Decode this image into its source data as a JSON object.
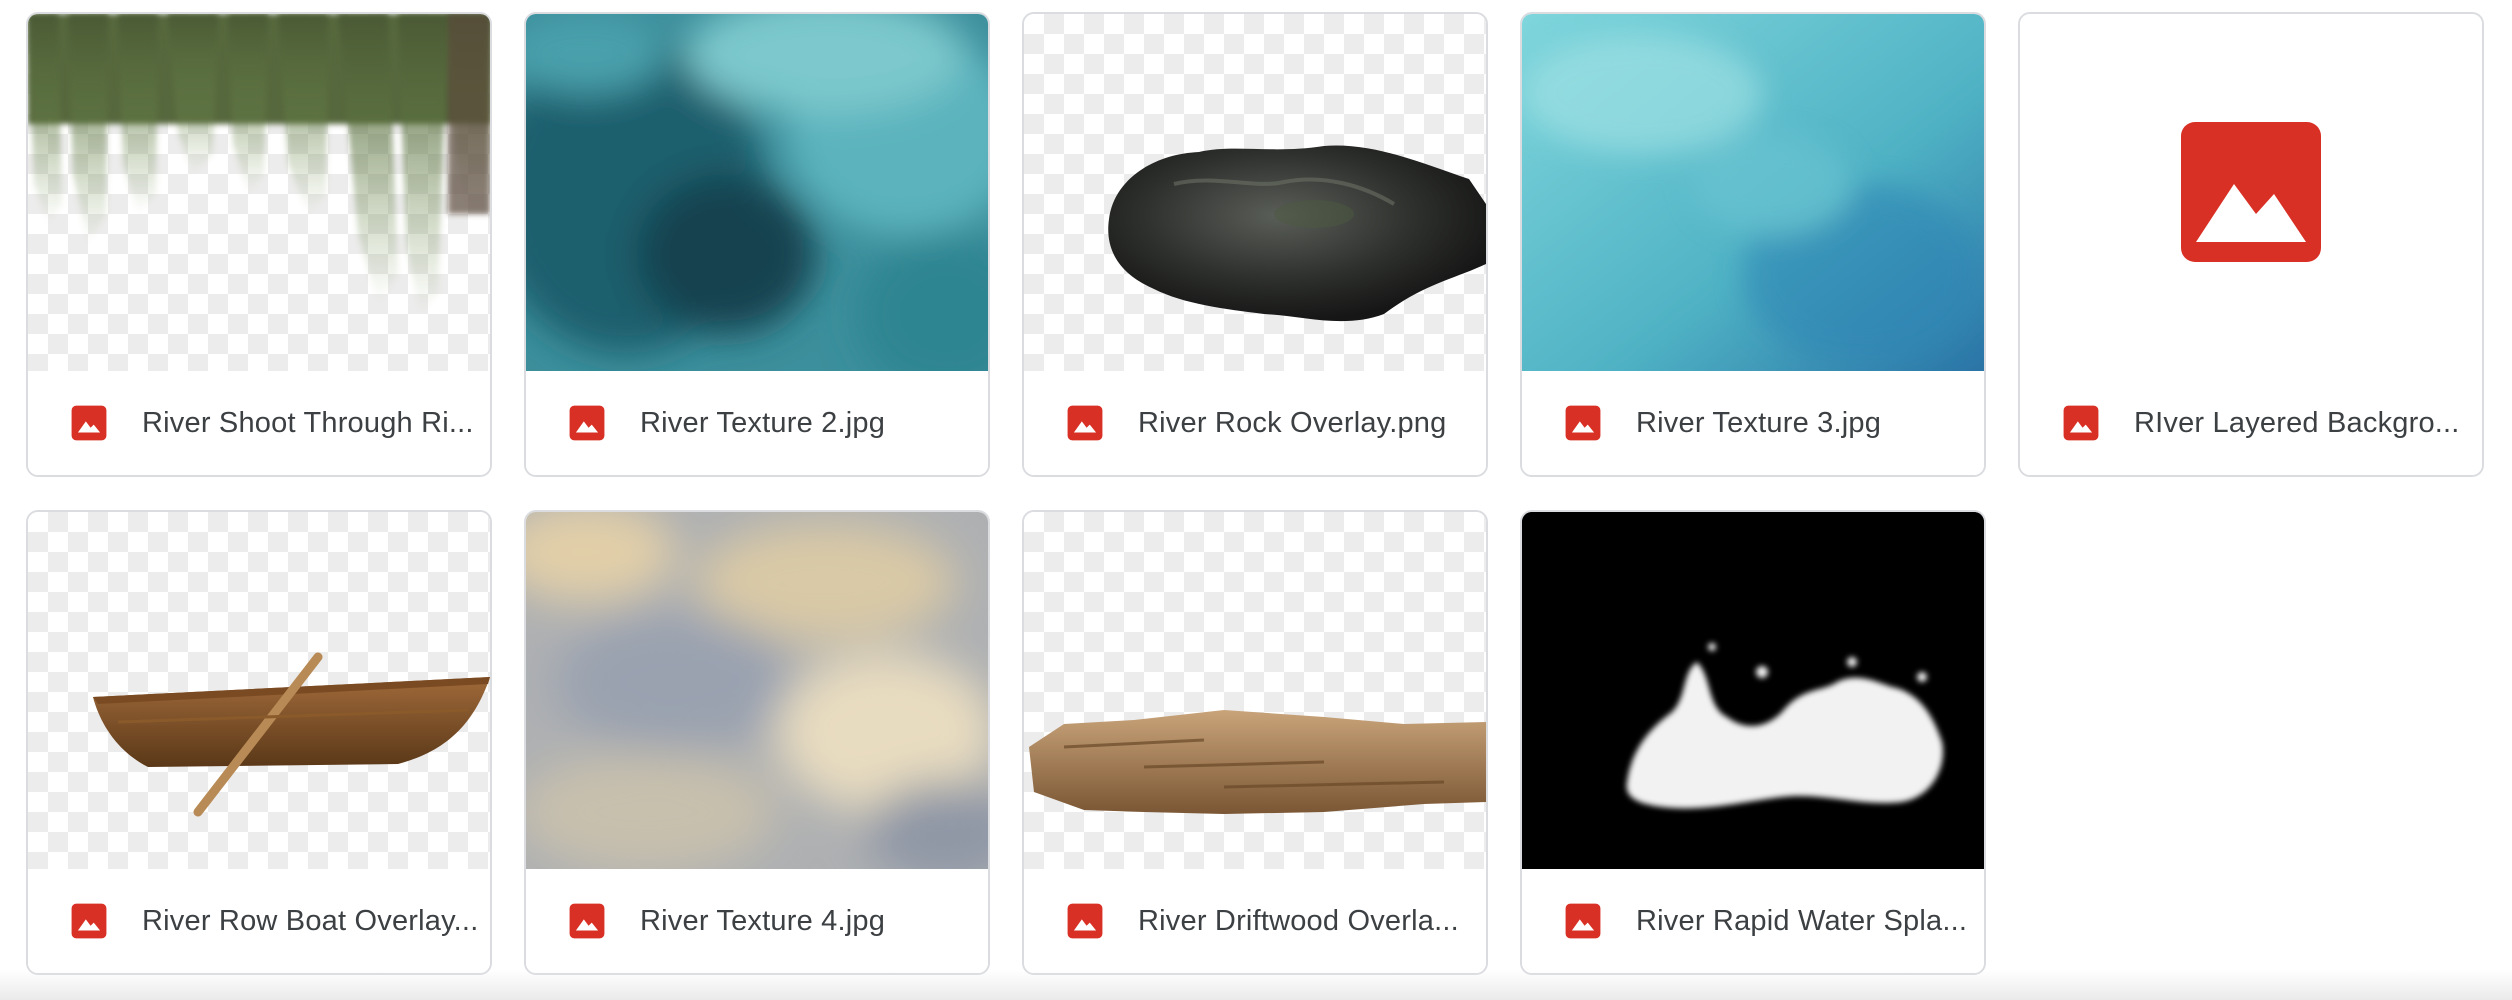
{
  "files": [
    {
      "name": "River Shoot Through Ri...",
      "type_icon": "image-icon",
      "thumb": "willow-branches"
    },
    {
      "name": "River Texture 2.jpg",
      "type_icon": "image-icon",
      "thumb": "teal-texture"
    },
    {
      "name": "River Rock Overlay.png",
      "type_icon": "image-icon",
      "thumb": "rock"
    },
    {
      "name": "River Texture 3.jpg",
      "type_icon": "image-icon",
      "thumb": "aqua-texture"
    },
    {
      "name": "RIver Layered Backgro...",
      "type_icon": "image-icon",
      "thumb": "generic-image-icon"
    },
    {
      "name": "River Row Boat Overlay...",
      "type_icon": "image-icon",
      "thumb": "row-boat"
    },
    {
      "name": "River Texture 4.jpg",
      "type_icon": "image-icon",
      "thumb": "blurred-water"
    },
    {
      "name": "River Driftwood Overla...",
      "type_icon": "image-icon",
      "thumb": "driftwood"
    },
    {
      "name": "River Rapid Water Spla...",
      "type_icon": "image-icon",
      "thumb": "water-splash"
    }
  ],
  "colors": {
    "icon_red": "#d93025",
    "border": "#dadce0",
    "text": "#3c4043"
  }
}
